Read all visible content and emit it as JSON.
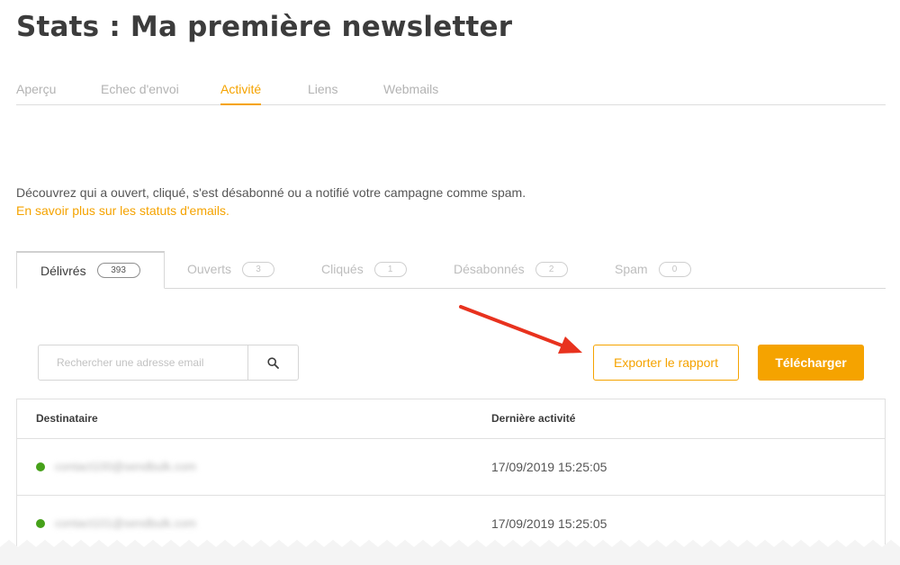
{
  "page": {
    "title": "Stats : Ma première newsletter"
  },
  "top_tabs": [
    {
      "label": "Aperçu",
      "active": false
    },
    {
      "label": "Echec d'envoi",
      "active": false
    },
    {
      "label": "Activité",
      "active": true
    },
    {
      "label": "Liens",
      "active": false
    },
    {
      "label": "Webmails",
      "active": false
    }
  ],
  "intro": {
    "text": "Découvrez qui a ouvert, cliqué, s'est désabonné ou a notifié votre campagne comme spam.",
    "link": "En savoir plus sur les statuts d'emails."
  },
  "status_tabs": [
    {
      "label": "Délivrés",
      "count": "393",
      "active": true
    },
    {
      "label": "Ouverts",
      "count": "3",
      "active": false
    },
    {
      "label": "Cliqués",
      "count": "1",
      "active": false
    },
    {
      "label": "Désabonnés",
      "count": "2",
      "active": false
    },
    {
      "label": "Spam",
      "count": "0",
      "active": false
    }
  ],
  "search": {
    "placeholder": "Rechercher une adresse email",
    "icon": "search-icon"
  },
  "actions": {
    "export_label": "Exporter le rapport",
    "download_label": "Télécharger"
  },
  "table": {
    "columns": [
      "Destinataire",
      "Dernière activité"
    ],
    "rows": [
      {
        "email": "contact100@sendbulk.com",
        "date": "17/09/2019 15:25:05",
        "status_color": "#46a11a"
      },
      {
        "email": "contact101@sendbulk.com",
        "date": "17/09/2019 15:25:05",
        "status_color": "#46a11a"
      }
    ]
  },
  "colors": {
    "accent": "#f5a300",
    "status_delivered": "#46a11a",
    "annotation_arrow": "#e8321e"
  }
}
